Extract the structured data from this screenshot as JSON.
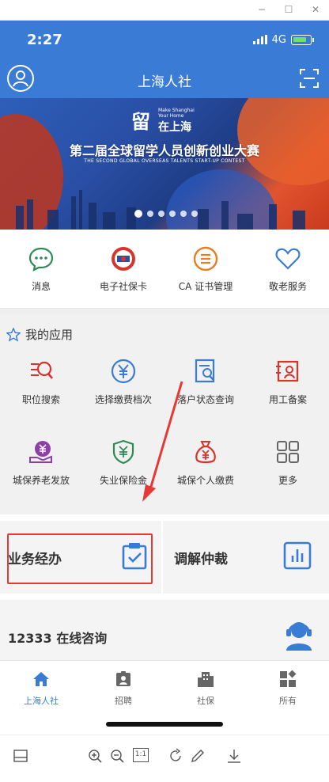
{
  "window": {
    "minimize": "−",
    "maximize": "☐",
    "close": "✕"
  },
  "status": {
    "time": "2:27",
    "network": "4G"
  },
  "header": {
    "title": "上海人社"
  },
  "banner": {
    "logo_main": "留",
    "logo_text": "在上海",
    "logo_tagline": "Make Shanghai Your Home",
    "title": "第二届全球留学人员创新创业大赛",
    "subtitle": "THE SECOND GLOBAL OVERSEAS TALENTS START-UP CONTEST",
    "slides": 6,
    "active_slide": 0
  },
  "quick": [
    {
      "label": "消息",
      "icon": "message-icon"
    },
    {
      "label": "电子社保卡",
      "icon": "social-card-icon"
    },
    {
      "label": "CA 证书管理",
      "icon": "ca-cert-icon"
    },
    {
      "label": "敬老服务",
      "icon": "heart-icon"
    }
  ],
  "apps": {
    "title": "我的应用",
    "items": [
      {
        "label": "职位搜索",
        "icon": "job-search-icon"
      },
      {
        "label": "选择缴费档次",
        "icon": "yuan-icon"
      },
      {
        "label": "落户状态查询",
        "icon": "settle-query-icon"
      },
      {
        "label": "用工备案",
        "icon": "employment-filing-icon"
      },
      {
        "label": "城保养老发放",
        "icon": "pension-icon"
      },
      {
        "label": "失业保险金",
        "icon": "unemployment-icon"
      },
      {
        "label": "城保个人缴费",
        "icon": "money-bag-icon"
      },
      {
        "label": "更多",
        "icon": "more-grid-icon"
      }
    ]
  },
  "cards": {
    "left_label": "业务经办",
    "right_label": "调解仲裁"
  },
  "consult": {
    "label": "12333 在线咨询"
  },
  "tabs": [
    {
      "label": "上海人社",
      "icon": "home-icon",
      "active": true
    },
    {
      "label": "招聘",
      "icon": "recruit-icon",
      "active": false
    },
    {
      "label": "社保",
      "icon": "building-icon",
      "active": false
    },
    {
      "label": "所有",
      "icon": "all-grid-icon",
      "active": false
    }
  ],
  "toolbar": {
    "page_ratio": "1:1"
  },
  "colors": {
    "brand": "#3a7bd5",
    "highlight": "#e53935",
    "red_icon": "#c0392b",
    "green_icon": "#2e8b57",
    "orange_icon": "#e67e22"
  }
}
